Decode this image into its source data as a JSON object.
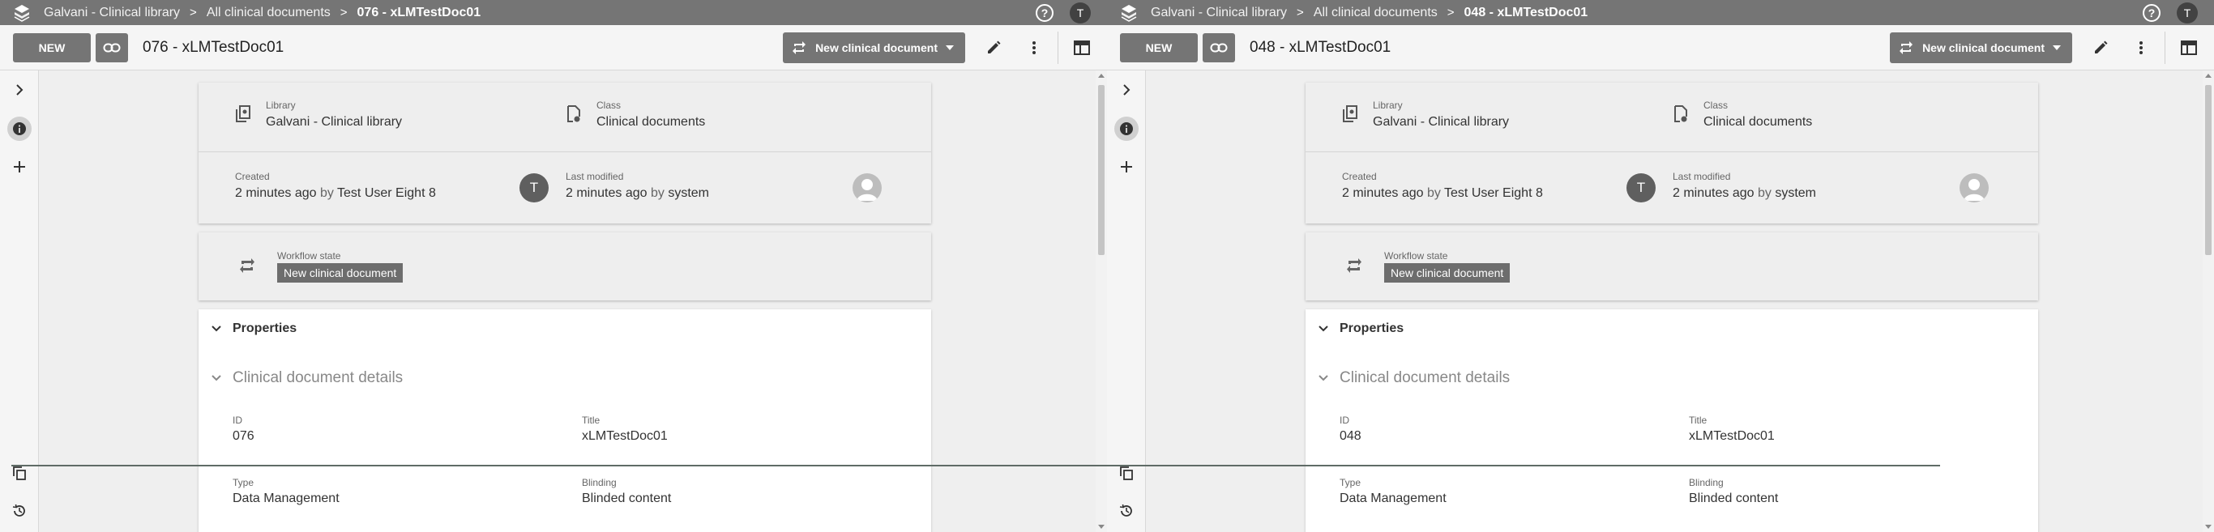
{
  "app": {
    "logo_icon": "stacked-layers-icon",
    "help_label": "?",
    "user_initial": "T"
  },
  "panes": [
    {
      "breadcrumb": [
        "Galvani - Clinical library",
        "All clinical documents",
        "076 - xLMTestDoc01"
      ],
      "toolbar": {
        "new_label": "NEW",
        "title": "076 - xLMTestDoc01",
        "state_button": "New clinical document"
      },
      "meta": {
        "library_label": "Library",
        "library_value": "Galvani - Clinical library",
        "class_label": "Class",
        "class_value": "Clinical documents",
        "created_label": "Created",
        "created_when": "2 minutes ago",
        "by_word": "by",
        "created_by": "Test User Eight 8",
        "creator_initial": "T",
        "modified_label": "Last modified",
        "modified_when": "2 minutes ago",
        "modified_by": "system"
      },
      "workflow": {
        "label": "Workflow state",
        "state": "New clinical document"
      },
      "properties": {
        "title": "Properties",
        "section": "Clinical document details",
        "id_label": "ID",
        "id_value": "076",
        "title_label": "Title",
        "title_value": "xLMTestDoc01",
        "type_label": "Type",
        "type_value": "Data Management",
        "blinding_label": "Blinding",
        "blinding_value": "Blinded content"
      }
    },
    {
      "breadcrumb": [
        "Galvani - Clinical library",
        "All clinical documents",
        "048 - xLMTestDoc01"
      ],
      "toolbar": {
        "new_label": "NEW",
        "title": "048 - xLMTestDoc01",
        "state_button": "New clinical document"
      },
      "meta": {
        "library_label": "Library",
        "library_value": "Galvani - Clinical library",
        "class_label": "Class",
        "class_value": "Clinical documents",
        "created_label": "Created",
        "created_when": "2 minutes ago",
        "by_word": "by",
        "created_by": "Test User Eight 8",
        "creator_initial": "T",
        "modified_label": "Last modified",
        "modified_when": "2 minutes ago",
        "modified_by": "system"
      },
      "workflow": {
        "label": "Workflow state",
        "state": "New clinical document"
      },
      "properties": {
        "title": "Properties",
        "section": "Clinical document details",
        "id_label": "ID",
        "id_value": "048",
        "title_label": "Title",
        "title_value": "xLMTestDoc01",
        "type_label": "Type",
        "type_value": "Data Management",
        "blinding_label": "Blinding",
        "blinding_value": "Blinded content"
      }
    }
  ],
  "colors": {
    "appbar": "#757575",
    "button": "#757575",
    "badge": "#6d6d6d",
    "page_bg": "#efefef"
  }
}
